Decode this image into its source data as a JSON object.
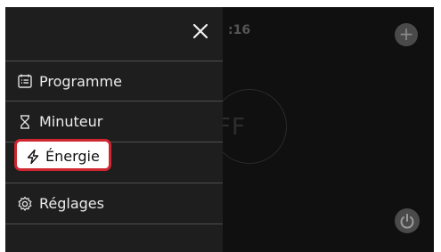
{
  "background": {
    "clock_text": ":16",
    "ring_text": "FF"
  },
  "drawer": {
    "close_icon": "close-icon",
    "items": [
      {
        "label": "Programme",
        "icon": "calendar-list-icon"
      },
      {
        "label": "Minuteur",
        "icon": "hourglass-icon"
      },
      {
        "label": "Énergie",
        "icon": "lightning-icon",
        "highlighted": true
      },
      {
        "label": "Réglages",
        "icon": "gear-icon"
      }
    ]
  },
  "colors": {
    "highlight_border": "#d0262f",
    "drawer_bg": "#1e1e1e",
    "screen_bg": "#101010"
  }
}
